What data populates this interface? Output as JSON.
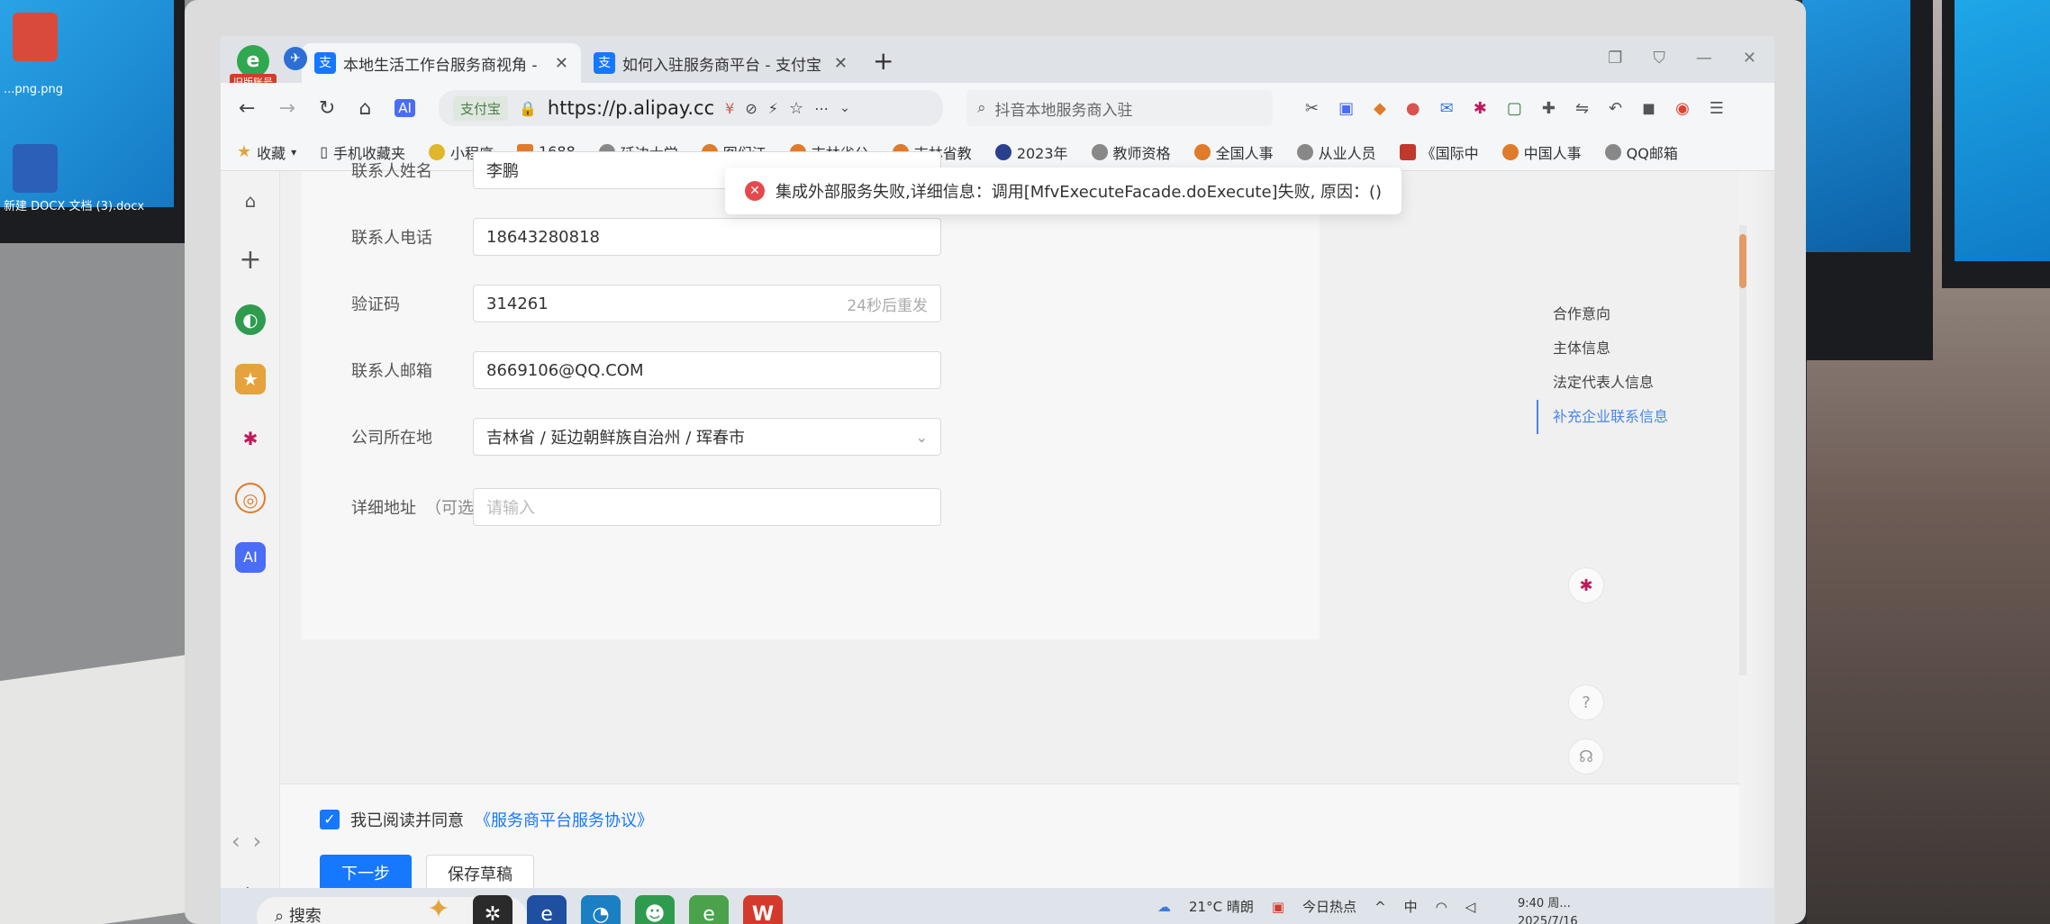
{
  "desktop": {
    "left_icons": [
      {
        "label": "...png.png",
        "color": "#d94a3b"
      },
      {
        "label": "新建 DOCX 文档 (3).docx",
        "color": "#2b5fb8"
      }
    ]
  },
  "browser": {
    "logo_badge": "旧版账号",
    "tabs": [
      {
        "title": "本地生活工作台服务商视角 -",
        "icon": "alipay-icon",
        "active": true
      },
      {
        "title": "如何入驻服务商平台 - 支付宝",
        "icon": "alipay-icon",
        "active": false
      }
    ],
    "address": {
      "site_tag": "支付宝",
      "url": "https://p.alipay.cc"
    },
    "search_text": "抖音本地服务商入驻",
    "bookmarks": [
      "收藏",
      "手机收藏夹",
      "小程序",
      "1688",
      "延边大学",
      "图们江",
      "吉林省公",
      "吉林省教",
      "2023年",
      "教师资格",
      "全国人事",
      "从业人员",
      "《国际中",
      "中国人事",
      "QQ邮箱"
    ]
  },
  "toast": {
    "message": "集成外部服务失败,详细信息：调用[MfvExecuteFacade.doExecute]失败, 原因：()"
  },
  "form": {
    "rows": [
      {
        "label": "联系人姓名",
        "value": "李鹏"
      },
      {
        "label": "联系人电话",
        "value": "18643280818"
      },
      {
        "label": "验证码",
        "value": "314261",
        "suffix": "24秒后重发"
      },
      {
        "label": "联系人邮箱",
        "value": "8669106@QQ.COM"
      },
      {
        "label": "公司所在地",
        "value": "吉林省 / 延边朝鲜族自治州 / 珲春市"
      },
      {
        "label": "详细地址",
        "optional": "（可选）",
        "placeholder": "请输入"
      }
    ]
  },
  "anchors": [
    {
      "label": "合作意向",
      "active": false
    },
    {
      "label": "主体信息",
      "active": false
    },
    {
      "label": "法定代表人信息",
      "active": false
    },
    {
      "label": "补充企业联系信息",
      "active": true
    }
  ],
  "footer": {
    "agree_text": "我已阅读并同意",
    "agree_link": "《服务商平台服务协议》",
    "agree_checked": true,
    "next_label": "下一步",
    "draft_label": "保存草稿"
  },
  "taskbar": {
    "search_label": "搜索",
    "weather_temp": "21°C",
    "weather_desc": "晴朗",
    "news_label": "今日热点",
    "ime_label": "中",
    "time": "9:40 周...",
    "date": "2025/7/16"
  },
  "colors": {
    "accent": "#1677ff",
    "error": "#e5484d",
    "anchor_active": "#4a86e8"
  }
}
